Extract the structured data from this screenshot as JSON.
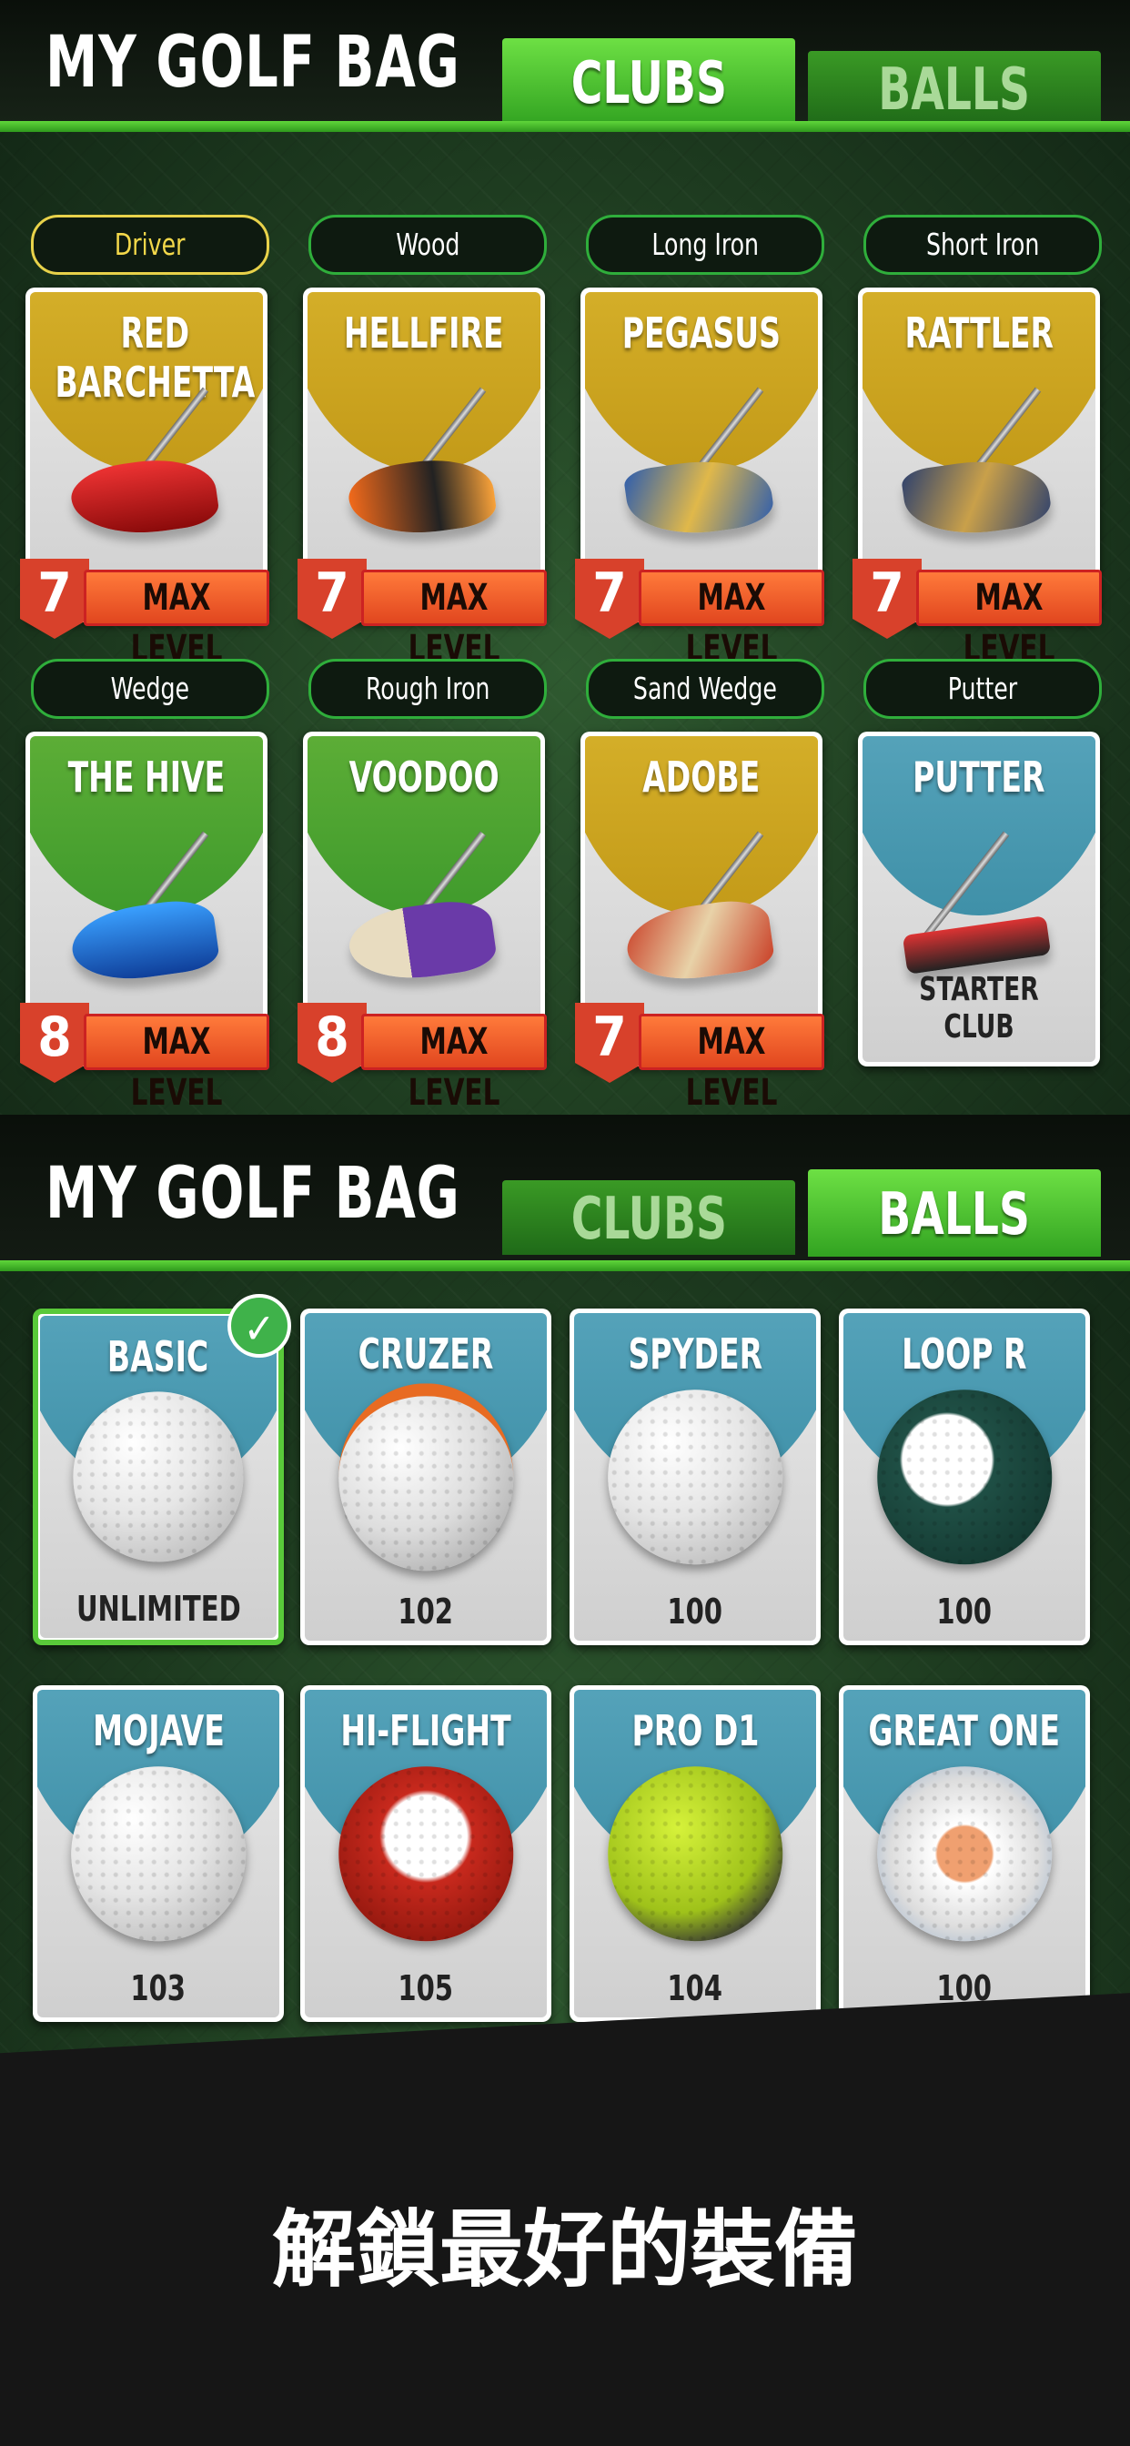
{
  "screen1": {
    "title": "MY GOLF BAG",
    "tabs": [
      {
        "label": "CLUBS",
        "active": true
      },
      {
        "label": "BALLS",
        "active": false
      }
    ],
    "categories": [
      "Driver",
      "Wood",
      "Long Iron",
      "Short Iron",
      "Wedge",
      "Rough Iron",
      "Sand Wedge",
      "Putter"
    ],
    "clubs": [
      {
        "name": "RED BARCHETTA",
        "level": "7",
        "status": "MAX LEVEL",
        "color": "gold"
      },
      {
        "name": "HELLFIRE",
        "level": "7",
        "status": "MAX LEVEL",
        "color": "gold"
      },
      {
        "name": "PEGASUS",
        "level": "7",
        "status": "MAX LEVEL",
        "color": "gold"
      },
      {
        "name": "RATTLER",
        "level": "7",
        "status": "MAX LEVEL",
        "color": "gold"
      },
      {
        "name": "THE HIVE",
        "level": "8",
        "status": "MAX LEVEL",
        "color": "green"
      },
      {
        "name": "VOODOO",
        "level": "8",
        "status": "MAX LEVEL",
        "color": "green"
      },
      {
        "name": "ADOBE",
        "level": "7",
        "status": "MAX LEVEL",
        "color": "gold"
      },
      {
        "name": "PUTTER",
        "status": "STARTER CLUB",
        "color": "teal"
      }
    ]
  },
  "screen2": {
    "title": "MY GOLF BAG",
    "tabs": [
      {
        "label": "CLUBS",
        "active": false
      },
      {
        "label": "BALLS",
        "active": true
      }
    ],
    "balls": [
      {
        "name": "BASIC",
        "count": "UNLIMITED",
        "selected": true
      },
      {
        "name": "CRUZER",
        "count": "102"
      },
      {
        "name": "SPYDER",
        "count": "100"
      },
      {
        "name": "LOOP R",
        "count": "100"
      },
      {
        "name": "MOJAVE",
        "count": "103"
      },
      {
        "name": "HI-FLIGHT",
        "count": "105"
      },
      {
        "name": "PRO D1",
        "count": "104"
      },
      {
        "name": "GREAT ONE",
        "count": "100"
      }
    ]
  },
  "promo_text": "解鎖最好的裝備",
  "colors": {
    "accent_green": "#4fc531",
    "gold": "#d6b12a",
    "teal": "#4fa2b9",
    "level_orange": "#ef5a2a"
  }
}
